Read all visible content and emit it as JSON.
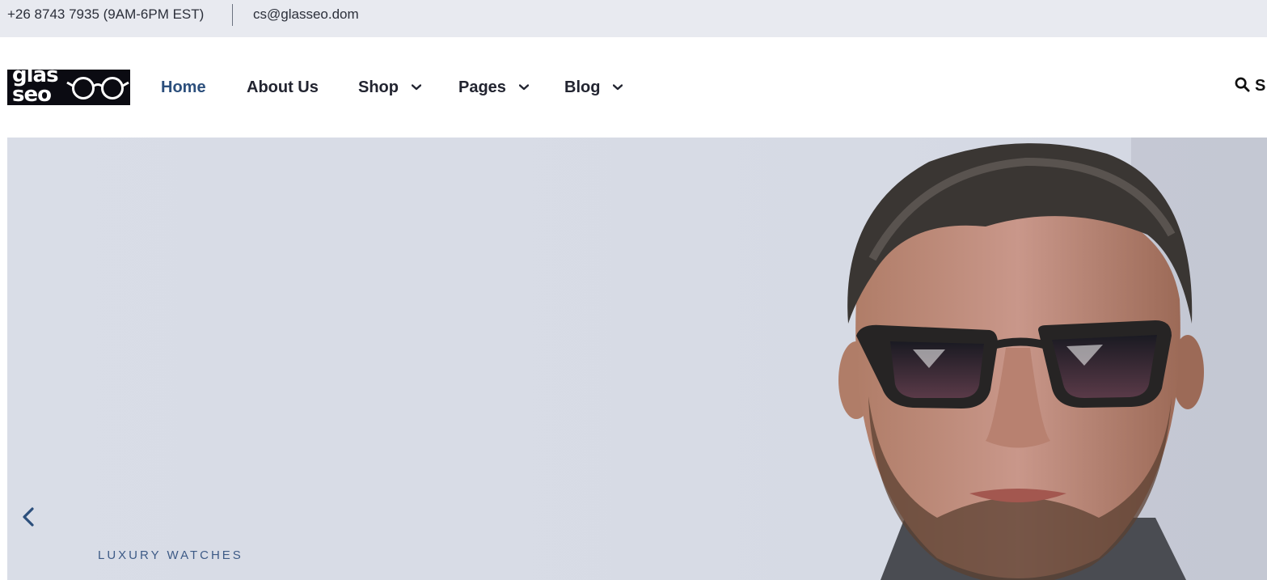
{
  "topbar": {
    "phone": "+26 8743 7935 (9AM-6PM EST)",
    "email": "cs@glasseo.dom"
  },
  "logo": {
    "line1": "glas",
    "line2": "seo"
  },
  "nav": {
    "items": [
      {
        "label": "Home",
        "active": true,
        "dropdown": false
      },
      {
        "label": "About Us",
        "active": false,
        "dropdown": false
      },
      {
        "label": "Shop",
        "active": false,
        "dropdown": true
      },
      {
        "label": "Pages",
        "active": false,
        "dropdown": true
      },
      {
        "label": "Blog",
        "active": false,
        "dropdown": true
      }
    ]
  },
  "search": {
    "label": "S",
    "icon": "search-icon"
  },
  "hero": {
    "tagline": "LUXURY WATCHES",
    "prev_icon": "chevron-left-icon",
    "image": "man-with-sunglasses"
  },
  "colors": {
    "accent": "#2c4f7c",
    "topbar_bg": "#e8eaf0",
    "hero_bg": "#d8dce6",
    "logo_bg": "#0b0b12"
  }
}
